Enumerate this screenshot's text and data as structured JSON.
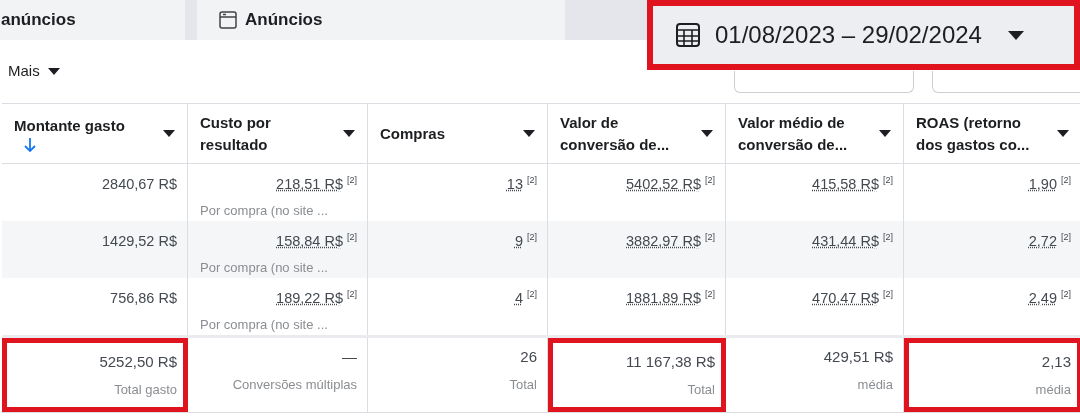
{
  "tabs": [
    {
      "label": "anúncios"
    },
    {
      "label": "Anúncios"
    }
  ],
  "date_range": {
    "label": "01/08/2023 – 29/02/2024",
    "highlighted": true
  },
  "toolbar": {
    "more": "Mais"
  },
  "table": {
    "columns": [
      {
        "label": "Montante gasto",
        "sorted": true
      },
      {
        "label": "Custo por resultado",
        "sorted": false
      },
      {
        "label": "Compras",
        "sorted": false
      },
      {
        "label": "Valor de conversão de...",
        "sorted": false
      },
      {
        "label": "Valor médio de conversão de...",
        "sorted": false
      },
      {
        "label": "ROAS (retorno dos gastos co...",
        "sorted": false
      }
    ],
    "rows": [
      {
        "cells": [
          {
            "value": "2840,67 R$"
          },
          {
            "value": "218,51 R$",
            "note": "[2]",
            "sub": "Por compra (no site ..."
          },
          {
            "value": "13",
            "note": "[2]"
          },
          {
            "value": "5402,52 R$",
            "note": "[2]"
          },
          {
            "value": "415,58 R$",
            "note": "[2]"
          },
          {
            "value": "1,90",
            "note": "[2]"
          }
        ]
      },
      {
        "cells": [
          {
            "value": "1429,52 R$"
          },
          {
            "value": "158,84 R$",
            "note": "[2]",
            "sub": "Por compra (no site ..."
          },
          {
            "value": "9",
            "note": "[2]"
          },
          {
            "value": "3882,97 R$",
            "note": "[2]"
          },
          {
            "value": "431,44 R$",
            "note": "[2]"
          },
          {
            "value": "2,72",
            "note": "[2]"
          }
        ]
      },
      {
        "cells": [
          {
            "value": "756,86 R$"
          },
          {
            "value": "189,22 R$",
            "note": "[2]",
            "sub": "Por compra (no site ..."
          },
          {
            "value": "4",
            "note": "[2]"
          },
          {
            "value": "1881,89 R$",
            "note": "[2]"
          },
          {
            "value": "470,47 R$",
            "note": "[2]"
          },
          {
            "value": "2,49",
            "note": "[2]"
          }
        ]
      }
    ],
    "totals": [
      {
        "value": "5252,50 R$",
        "label": "Total gasto",
        "highlighted": true
      },
      {
        "value": "—",
        "label": "Conversões múltiplas",
        "highlighted": false
      },
      {
        "value": "26",
        "label": "Total",
        "highlighted": false
      },
      {
        "value": "11 167,38 R$",
        "label": "Total",
        "highlighted": true
      },
      {
        "value": "429,51 R$",
        "label": "média",
        "highlighted": false
      },
      {
        "value": "2,13",
        "label": "média",
        "highlighted": true
      }
    ]
  }
}
